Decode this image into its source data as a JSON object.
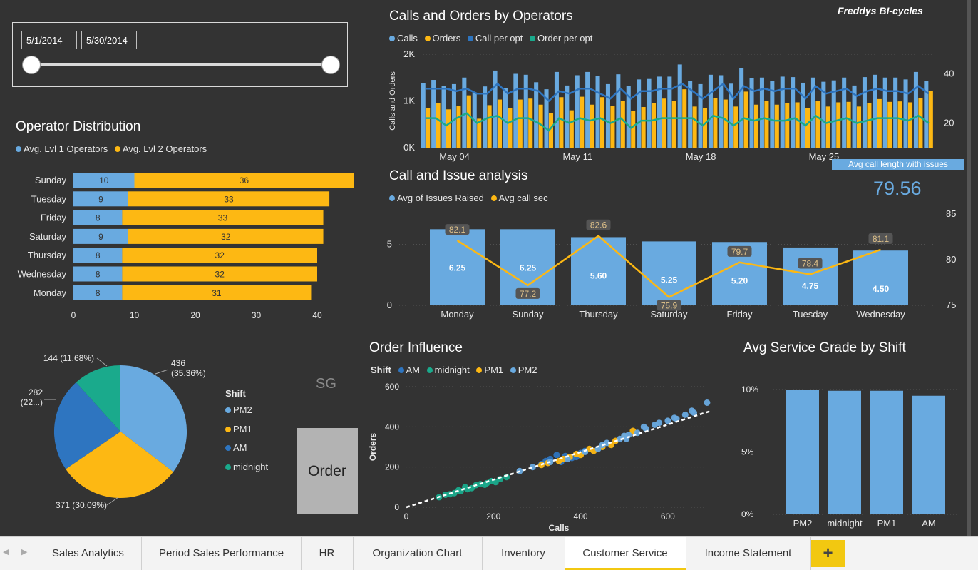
{
  "brand": "Freddys BI-cycles",
  "date_slicer": {
    "start": "5/1/2014",
    "end": "5/30/2014"
  },
  "operator_distribution": {
    "title": "Operator Distribution",
    "legend": [
      "Avg. Lvl 1 Operators",
      "Avg. Lvl 2 Operators"
    ],
    "colors": [
      "#69aae0",
      "#fdb813"
    ]
  },
  "calls_orders": {
    "title": "Calls and Orders by Operators",
    "legend": [
      "Calls",
      "Orders",
      "Call per opt",
      "Order per opt"
    ],
    "colors": [
      "#69aae0",
      "#fdb813",
      "#2e75c0",
      "#1aaa8c"
    ]
  },
  "call_issue": {
    "title": "Call and Issue analysis",
    "legend": [
      "Avg of Issues Raised",
      "Avg call sec"
    ],
    "colors": [
      "#69aae0",
      "#fdb813"
    ]
  },
  "kpi": {
    "label": "Avg call length with issues",
    "value": "79.56"
  },
  "shift_pie": {
    "legend_title": "Shift",
    "legend": [
      "PM2",
      "PM1",
      "AM",
      "midnight"
    ],
    "colors": [
      "#69aae0",
      "#fdb813",
      "#2e75c0",
      "#1aaa8c"
    ]
  },
  "sg_label": "SG",
  "order_button": "Order",
  "order_influence": {
    "title": "Order Influence",
    "legend_title": "Shift",
    "legend": [
      "AM",
      "midnight",
      "PM1",
      "PM2"
    ],
    "colors": [
      "#2e75c0",
      "#1aaa8c",
      "#fdb813",
      "#69aae0"
    ]
  },
  "service_grade": {
    "title": "Avg Service Grade by Shift"
  },
  "tabs": [
    "Sales Analytics",
    "Period Sales Performance",
    "HR",
    "Organization Chart",
    "Inventory",
    "Customer Service",
    "Income Statement"
  ],
  "active_tab": "Customer Service",
  "add_tab_label": "+",
  "chart_data": [
    {
      "id": "operator-distribution",
      "type": "bar",
      "orientation": "horizontal",
      "stacked": true,
      "categories": [
        "Sunday",
        "Tuesday",
        "Friday",
        "Saturday",
        "Thursday",
        "Wednesday",
        "Monday"
      ],
      "series": [
        {
          "name": "Avg. Lvl 1 Operators",
          "values": [
            10,
            9,
            8,
            9,
            8,
            8,
            8
          ]
        },
        {
          "name": "Avg. Lvl 2 Operators",
          "values": [
            36,
            33,
            33,
            32,
            32,
            32,
            31
          ]
        }
      ],
      "xticks": [
        "0",
        "10",
        "20",
        "30",
        "40",
        "50"
      ],
      "xlim": [
        0,
        50
      ]
    },
    {
      "id": "calls-orders-by-operators",
      "type": "bar",
      "x_labels": [
        "May 04",
        "May 11",
        "May 18",
        "May 25"
      ],
      "ylabel": "Calls and Orders",
      "yticks_left": [
        "0K",
        "1K",
        "2K"
      ],
      "yticks_right": [
        "20",
        "40"
      ],
      "ylim": [
        0,
        2000
      ],
      "y2lim": [
        10,
        48
      ],
      "series": [
        {
          "name": "Calls",
          "type": "bar",
          "values": [
            1380,
            1450,
            1320,
            1360,
            1500,
            1180,
            1310,
            1650,
            1280,
            1580,
            1560,
            1400,
            1250,
            1620,
            1330,
            1550,
            1620,
            1540,
            1360,
            1570,
            1320,
            1460,
            1470,
            1520,
            1520,
            1780,
            1430,
            1360,
            1560,
            1550,
            1370,
            1700,
            1490,
            1500,
            1430,
            1520,
            1510,
            1390,
            1500,
            1410,
            1440,
            1500,
            1330,
            1510,
            1560,
            1500,
            1500,
            1460,
            1620,
            1420
          ]
        },
        {
          "name": "Orders",
          "type": "bar",
          "values": [
            850,
            950,
            820,
            900,
            1120,
            620,
            910,
            1030,
            840,
            1030,
            1050,
            920,
            740,
            1080,
            800,
            1090,
            920,
            1080,
            890,
            1000,
            790,
            870,
            960,
            1050,
            1000,
            1250,
            880,
            850,
            1060,
            1030,
            880,
            1200,
            920,
            1000,
            920,
            950,
            970,
            850,
            1000,
            880,
            970,
            980,
            880,
            960,
            1040,
            980,
            990,
            970,
            1060,
            1220
          ]
        },
        {
          "name": "Call per opt",
          "type": "line",
          "values": [
            34,
            34,
            34,
            33,
            34,
            32,
            32,
            36,
            32,
            34,
            34,
            33,
            29,
            33,
            32,
            34,
            34,
            32,
            30,
            34,
            30,
            33,
            33,
            34,
            34,
            36,
            33,
            30,
            33,
            36,
            30,
            35,
            33,
            34,
            33,
            34,
            34,
            30,
            35,
            32,
            33,
            34,
            31,
            33,
            34,
            33,
            33,
            32,
            35,
            32
          ]
        },
        {
          "name": "Order per opt",
          "type": "line",
          "values": [
            22,
            22,
            19,
            22,
            24,
            20,
            22,
            23,
            20,
            22,
            22,
            20,
            17,
            22,
            20,
            22,
            21,
            22,
            20,
            22,
            18,
            21,
            21,
            22,
            22,
            22,
            22,
            19,
            23,
            22,
            19,
            22,
            21,
            22,
            21,
            21,
            22,
            19,
            23,
            20,
            21,
            22,
            20,
            21,
            22,
            22,
            22,
            21,
            23,
            20
          ]
        }
      ]
    },
    {
      "id": "call-issue-analysis",
      "type": "bar",
      "categories": [
        "Monday",
        "Sunday",
        "Thursday",
        "Saturday",
        "Friday",
        "Tuesday",
        "Wednesday"
      ],
      "series": [
        {
          "name": "Avg of Issues Raised",
          "type": "bar",
          "values": [
            6.25,
            6.25,
            5.6,
            5.25,
            5.2,
            4.75,
            4.5
          ]
        },
        {
          "name": "Avg call sec",
          "type": "line",
          "values": [
            82.1,
            77.2,
            82.6,
            75.9,
            79.7,
            78.4,
            81.1
          ]
        }
      ],
      "yticks_left": [
        "0",
        "5"
      ],
      "yticks_right": [
        "75",
        "80",
        "85"
      ],
      "ylim": [
        0,
        7.5
      ],
      "y2lim": [
        75,
        85
      ]
    },
    {
      "id": "shift-pie",
      "type": "pie",
      "labels": [
        "PM2",
        "PM1",
        "AM",
        "midnight"
      ],
      "values": [
        436,
        371,
        282,
        144
      ],
      "data_labels": [
        "436\n(35.36%)",
        "371 (30.09%)",
        "282\n(22...)",
        "144 (11.68%)"
      ]
    },
    {
      "id": "order-influence",
      "type": "scatter",
      "xlabel": "Calls",
      "ylabel": "Orders",
      "xticks": [
        "0",
        "200",
        "400",
        "600"
      ],
      "yticks": [
        "0",
        "200",
        "400",
        "600"
      ],
      "xlim": [
        0,
        700
      ],
      "ylim": [
        0,
        600
      ],
      "trendline": [
        [
          0,
          0
        ],
        [
          700,
          480
        ]
      ],
      "series": [
        {
          "name": "AM",
          "points": [
            [
              330,
              240
            ],
            [
              365,
              255
            ],
            [
              380,
              245
            ],
            [
              320,
              230
            ],
            [
              410,
              280
            ],
            [
              355,
              225
            ],
            [
              400,
              270
            ],
            [
              345,
              260
            ],
            [
              390,
              250
            ],
            [
              310,
              215
            ]
          ]
        },
        {
          "name": "midnight",
          "points": [
            [
              75,
              50
            ],
            [
              90,
              62
            ],
            [
              110,
              70
            ],
            [
              125,
              80
            ],
            [
              140,
              90
            ],
            [
              150,
              95
            ],
            [
              160,
              110
            ],
            [
              170,
              115
            ],
            [
              185,
              120
            ],
            [
              195,
              130
            ],
            [
              205,
              125
            ],
            [
              215,
              140
            ],
            [
              230,
              150
            ],
            [
              120,
              85
            ],
            [
              100,
              65
            ],
            [
              135,
              100
            ],
            [
              180,
              112
            ]
          ]
        },
        {
          "name": "PM1",
          "points": [
            [
              310,
              210
            ],
            [
              325,
              220
            ],
            [
              350,
              230
            ],
            [
              375,
              250
            ],
            [
              390,
              265
            ],
            [
              420,
              290
            ],
            [
              450,
              300
            ],
            [
              470,
              310
            ],
            [
              500,
              350
            ],
            [
              520,
              380
            ],
            [
              480,
              330
            ],
            [
              430,
              280
            ],
            [
              360,
              240
            ],
            [
              400,
              260
            ]
          ]
        },
        {
          "name": "PM2",
          "points": [
            [
              260,
              180
            ],
            [
              290,
              200
            ],
            [
              330,
              225
            ],
            [
              370,
              240
            ],
            [
              410,
              275
            ],
            [
              440,
              290
            ],
            [
              460,
              320
            ],
            [
              490,
              340
            ],
            [
              510,
              360
            ],
            [
              530,
              370
            ],
            [
              550,
              390
            ],
            [
              570,
              410
            ],
            [
              600,
              430
            ],
            [
              620,
              440
            ],
            [
              640,
              460
            ],
            [
              660,
              470
            ],
            [
              690,
              520
            ],
            [
              545,
              400
            ],
            [
              580,
              420
            ],
            [
              500,
              355
            ],
            [
              450,
              310
            ],
            [
              615,
              445
            ],
            [
              655,
              480
            ],
            [
              505,
              340
            ]
          ]
        }
      ]
    },
    {
      "id": "service-grade",
      "type": "bar",
      "categories": [
        "PM2",
        "midnight",
        "PM1",
        "AM"
      ],
      "values": [
        0.1,
        0.099,
        0.099,
        0.095
      ],
      "yticks": [
        "0%",
        "5%",
        "10%"
      ],
      "ylim": [
        0,
        0.1
      ]
    }
  ]
}
